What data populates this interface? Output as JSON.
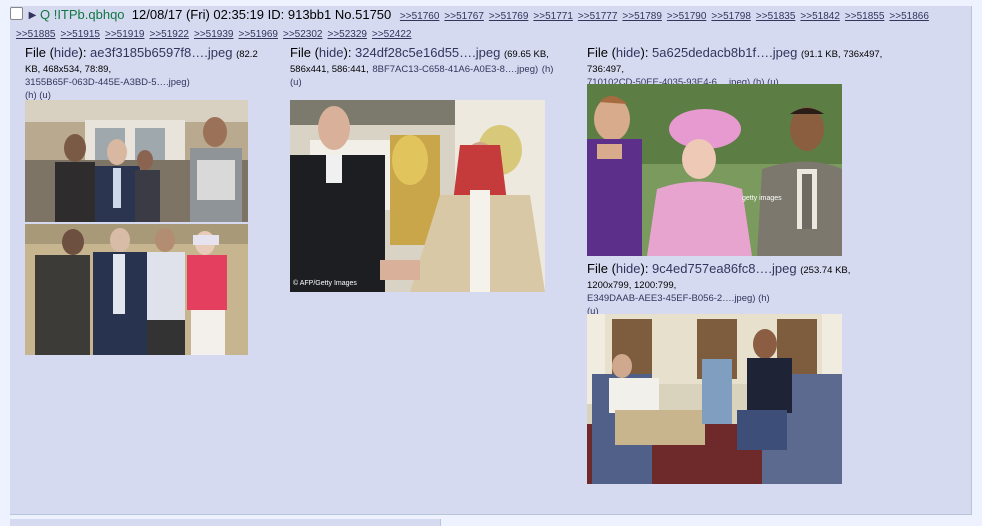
{
  "post": {
    "name": "Q",
    "tripcode": "!ITPb.qbhqo",
    "date": "12/08/17 (Fri) 02:35:19",
    "id": "ID: 913bb1",
    "number": "No.51750",
    "replies": [
      ">>51760",
      ">>51767",
      ">>51769",
      ">>51771",
      ">>51777",
      ">>51789",
      ">>51790",
      ">>51798",
      ">>51835",
      ">>51842",
      ">>51855",
      ">>51866",
      ">>51885",
      ">>51915",
      ">>51919",
      ">>51922",
      ">>51939",
      ">>51969",
      ">>52302",
      ">>52329",
      ">>52422"
    ]
  },
  "files": [
    {
      "label": "File",
      "hide": "hide",
      "filename": "ae3f3185b6597f8….jpeg",
      "meta": "(82.2 KB, 468x534, 78:89,",
      "original": "3155B65F-063D-445E-A3BD-5….jpeg)",
      "h": "(h)",
      "u": "(u)",
      "watermark": ""
    },
    {
      "label": "File",
      "hide": "hide",
      "filename": "324df28c5e16d55….jpeg",
      "meta": "(69.65 KB, 586x441, 586:441,",
      "original": "8BF7AC13-C658-41A6-A0E3-8….jpeg)",
      "h": "(h)",
      "u": "(u)",
      "watermark": "© AFP/Getty Images"
    },
    {
      "label": "File",
      "hide": "hide",
      "filename": "5a625dedacb8b1f….jpeg",
      "meta": "(91.1 KB, 736x497, 736:497,",
      "original": "710102CD-50EE-4035-93E4-6….jpeg)",
      "h": "(h)",
      "u": "(u)",
      "watermark": "getty images"
    },
    {
      "label": "File",
      "hide": "hide",
      "filename": "9c4ed757ea86fc8….jpeg",
      "meta": "(253.74 KB, 1200x799, 1200:799,",
      "original": "E349DAAB-AEE3-45EF-B056-2….jpeg)",
      "h": "(h)",
      "u": "(u)",
      "watermark": ""
    }
  ]
}
